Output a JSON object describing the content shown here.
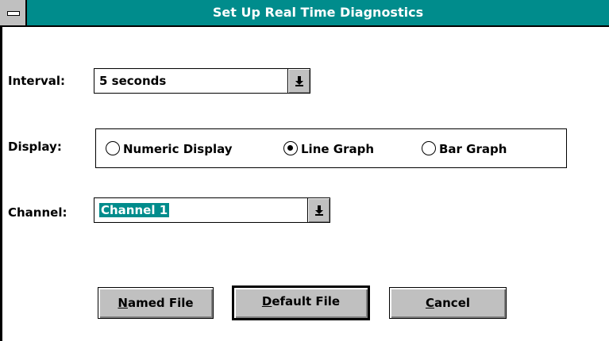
{
  "window": {
    "title": "Set Up Real Time Diagnostics"
  },
  "icons": {
    "system_menu": "system-menu-icon",
    "dropdown": "dropdown-arrow-icon"
  },
  "colors": {
    "titlebar": "#008c8c",
    "button_face": "#c0c0c0",
    "selection": "#008c8c"
  },
  "interval": {
    "label": "Interval:",
    "value": "5 seconds"
  },
  "display": {
    "label": "Display:",
    "options": [
      {
        "label": "Numeric Display",
        "selected": false
      },
      {
        "label": "Line Graph",
        "selected": true
      },
      {
        "label": "Bar Graph",
        "selected": false
      }
    ]
  },
  "channel": {
    "label": "Channel:",
    "value": "Channel 1"
  },
  "buttons": {
    "named_file": {
      "accel": "N",
      "rest": "amed File"
    },
    "default_file": {
      "accel": "D",
      "rest": "efault File"
    },
    "cancel": {
      "accel": "C",
      "rest": "ancel"
    }
  }
}
